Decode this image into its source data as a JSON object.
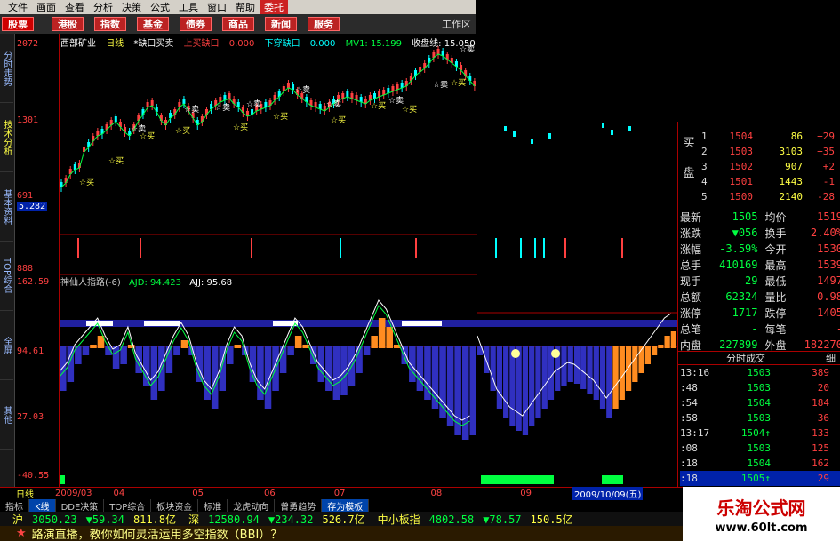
{
  "menu": [
    "文件",
    "画面",
    "查看",
    "分析",
    "决策",
    "公式",
    "工具",
    "窗口",
    "帮助",
    "委托"
  ],
  "toolbar": [
    "股票",
    "港股",
    "指数",
    "基金",
    "债券",
    "商品",
    "新闻",
    "服务"
  ],
  "workspace": "工作区",
  "left_tabs": [
    "分时走势",
    "技术分析",
    "基本资料",
    "TOP综合",
    "全屏",
    "其他"
  ],
  "main_info": {
    "name": "西部矿业",
    "period": "日线",
    "indicator": "*缺口买卖",
    "up_gap": "上买缺口",
    "up_gap_val": "0.000",
    "down_gap": "下穿缺口",
    "down_gap_val": "0.000",
    "mv1": "MV1: 15.199",
    "close": "收盘线: 15.050"
  },
  "y_labels_main": [
    "2072",
    "1301",
    "691",
    "5.282"
  ],
  "y_labels_vol": [
    "888"
  ],
  "y_labels_ind": [
    "162.59",
    "94.61",
    "27.03",
    "-40.55"
  ],
  "ind_info": {
    "name": "神仙人指路(-6)",
    "ajd": "AJD: 94.423",
    "ajj": "AJJ: 95.68"
  },
  "buy_sell_labels": {
    "buy": "买",
    "sell": "卖",
    "pre": "13"
  },
  "orderbook": {
    "title_buy": "买",
    "title_pan": "盘",
    "rows": [
      {
        "n": "1",
        "p": "1504",
        "v": "86",
        "c": "+29"
      },
      {
        "n": "2",
        "p": "1503",
        "v": "3103",
        "c": "+35"
      },
      {
        "n": "3",
        "p": "1502",
        "v": "907",
        "c": "+2"
      },
      {
        "n": "4",
        "p": "1501",
        "v": "1443",
        "c": "-1"
      },
      {
        "n": "5",
        "p": "1500",
        "v": "2140",
        "c": "-28"
      }
    ]
  },
  "stats": [
    {
      "k": "最新",
      "v": "1505",
      "k2": "均价",
      "v2": "1519"
    },
    {
      "k": "涨跌",
      "v": "▼056",
      "k2": "换手",
      "v2": "2.40%"
    },
    {
      "k": "涨幅",
      "v": "-3.59%",
      "k2": "今开",
      "v2": "1530"
    },
    {
      "k": "总手",
      "v": "410169",
      "k2": "最高",
      "v2": "1539"
    },
    {
      "k": "现手",
      "v": "29",
      "k2": "最低",
      "v2": "1497"
    },
    {
      "k": "总额",
      "v": "62324",
      "k2": "量比",
      "v2": "0.98"
    },
    {
      "k": "涨停",
      "v": "1717",
      "k2": "跌停",
      "v2": "1405"
    },
    {
      "k": "总笔",
      "v": "-",
      "k2": "每笔",
      "v2": "-"
    },
    {
      "k": "内盘",
      "v": "227899",
      "k2": "外盘",
      "v2": "182270"
    }
  ],
  "trades_title": "分时成交",
  "trades_tab": "细",
  "trades": [
    {
      "t": "13:16",
      "p": "1503",
      "v": "389",
      "vc": "#ff4040"
    },
    {
      "t": ":48",
      "p": "1503",
      "v": "20",
      "vc": "#ff4040"
    },
    {
      "t": ":54",
      "p": "1504",
      "v": "184",
      "vc": "#ff4040"
    },
    {
      "t": ":58",
      "p": "1503",
      "v": "36",
      "vc": "#ff4040"
    },
    {
      "t": "13:17",
      "p": "1504↑",
      "v": "133",
      "vc": "#ff4040"
    },
    {
      "t": ":08",
      "p": "1503",
      "v": "125",
      "vc": "#ff4040"
    },
    {
      "t": ":18",
      "p": "1504",
      "v": "162",
      "vc": "#ff4040"
    },
    {
      "t": ":18",
      "p": "1505↑",
      "v": "29",
      "vc": "#ff4040"
    }
  ],
  "date_axis": {
    "label": "日线",
    "dates": [
      "2009/03",
      "04",
      "05",
      "06",
      "07",
      "08",
      "09"
    ],
    "cursor": "2009/10/09(五)"
  },
  "bottom_tabs": [
    "指标",
    "K线",
    "DDE决策",
    "TOP综合",
    "板块资金",
    "标准",
    "龙虎动向",
    "曾勇趋势",
    "存为模板"
  ],
  "index_bar": [
    {
      "n": "沪",
      "v": "3050.23",
      "c": "▼59.34",
      "a": "811.8亿"
    },
    {
      "n": "深",
      "v": "12580.94",
      "c": "▼234.32",
      "a": "526.7亿"
    },
    {
      "n": "中小板指",
      "v": "4802.58",
      "c": "▼78.57",
      "a": "150.5亿"
    }
  ],
  "ticker": "路演直播，教你如何灵活运用多空指数（BBI）？",
  "watermark": {
    "title": "乐淘公式网",
    "url": "www.60lt.com"
  },
  "colors": {
    "up": "#ff4040",
    "down": "#00ffff",
    "price": "#00ff40",
    "ind_bar": "#3030c0",
    "orange": "#ff8c20"
  }
}
